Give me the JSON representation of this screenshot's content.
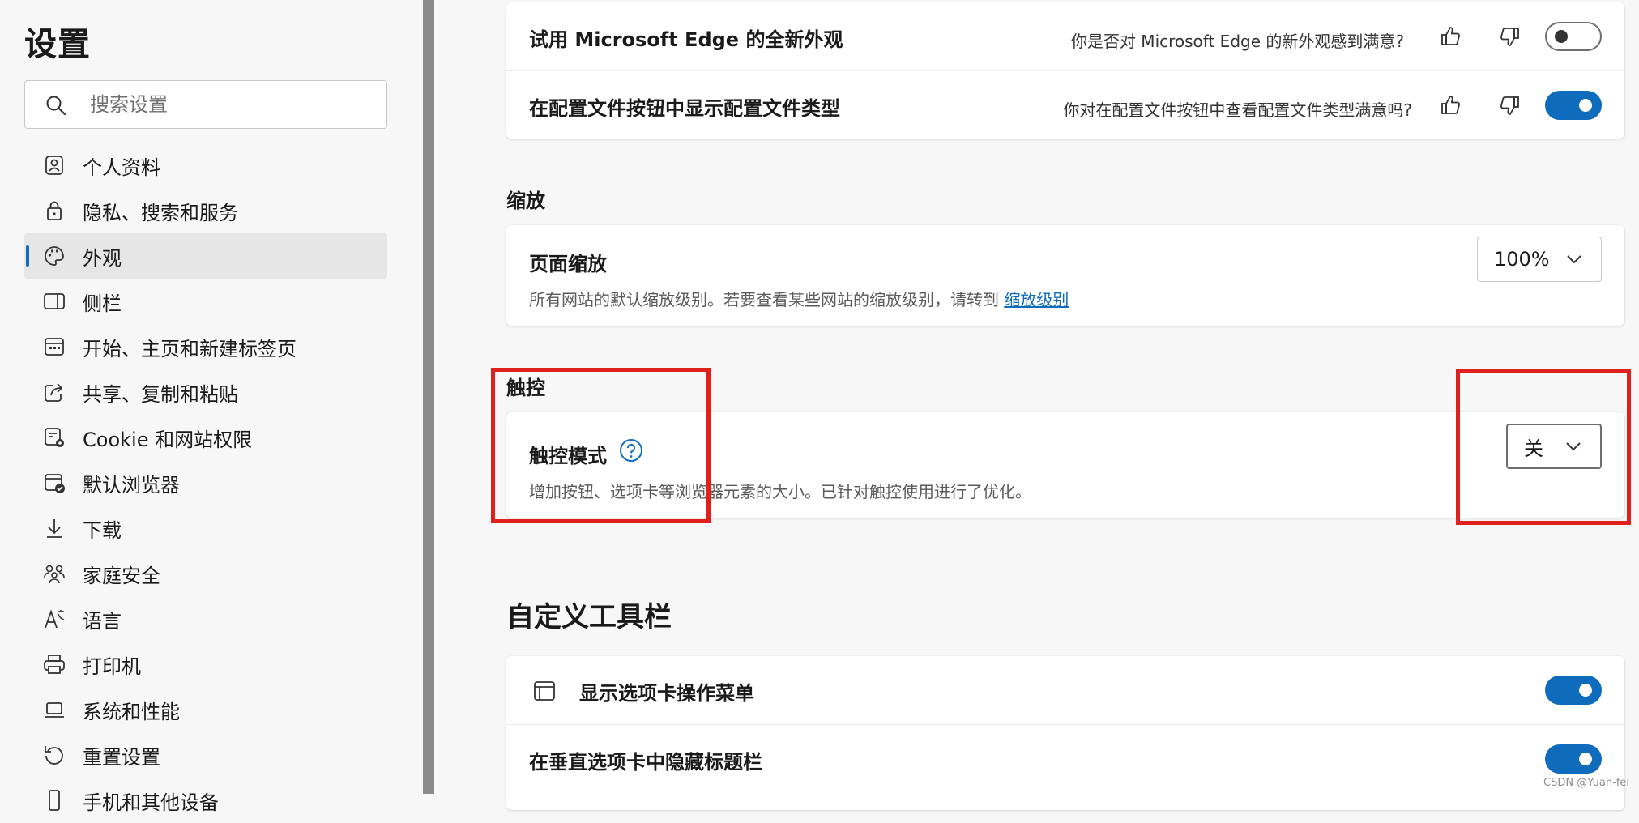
{
  "sidebar": {
    "title": "设置",
    "search_placeholder": "搜索设置",
    "items": [
      {
        "label": "个人资料",
        "icon": "profile-icon"
      },
      {
        "label": "隐私、搜索和服务",
        "icon": "lock-icon"
      },
      {
        "label": "外观",
        "icon": "palette-icon",
        "active": true
      },
      {
        "label": "侧栏",
        "icon": "sidebar-icon"
      },
      {
        "label": "开始、主页和新建标签页",
        "icon": "home-tab-icon"
      },
      {
        "label": "共享、复制和粘贴",
        "icon": "share-icon"
      },
      {
        "label": "Cookie 和网站权限",
        "icon": "cookie-icon"
      },
      {
        "label": "默认浏览器",
        "icon": "default-browser-icon"
      },
      {
        "label": "下载",
        "icon": "download-icon"
      },
      {
        "label": "家庭安全",
        "icon": "family-icon"
      },
      {
        "label": "语言",
        "icon": "language-icon"
      },
      {
        "label": "打印机",
        "icon": "printer-icon"
      },
      {
        "label": "系统和性能",
        "icon": "laptop-icon"
      },
      {
        "label": "重置设置",
        "icon": "reset-icon"
      },
      {
        "label": "手机和其他设备",
        "icon": "phone-icon"
      }
    ]
  },
  "main": {
    "feedback_card": {
      "rows": [
        {
          "label": "试用 Microsoft Edge 的全新外观",
          "question": "你是否对 Microsoft Edge 的新外观感到满意?",
          "toggle_on": false
        },
        {
          "label": "在配置文件按钮中显示配置文件类型",
          "question": "你对在配置文件按钮中查看配置文件类型满意吗?",
          "toggle_on": true
        }
      ]
    },
    "zoom": {
      "section_title": "缩放",
      "row_label": "页面缩放",
      "description": "所有网站的默认缩放级别。若要查看某些网站的缩放级别，请转到",
      "link_text": "缩放级别",
      "value": "100%"
    },
    "touch": {
      "section_title": "触控",
      "row_label": "触控模式",
      "description": "增加按钮、选项卡等浏览器元素的大小。已针对触控使用进行了优化。",
      "value": "关"
    },
    "toolbar": {
      "section_title": "自定义工具栏",
      "rows": [
        {
          "label": "显示选项卡操作菜单",
          "toggle_on": true
        },
        {
          "label": "在垂直选项卡中隐藏标题栏",
          "toggle_on": true
        }
      ]
    }
  },
  "watermark": "CSDN @Yuan-fei",
  "colors": {
    "accent": "#0f6cbd",
    "annotation": "#e0201c",
    "splitter": "#8a8a8a"
  }
}
